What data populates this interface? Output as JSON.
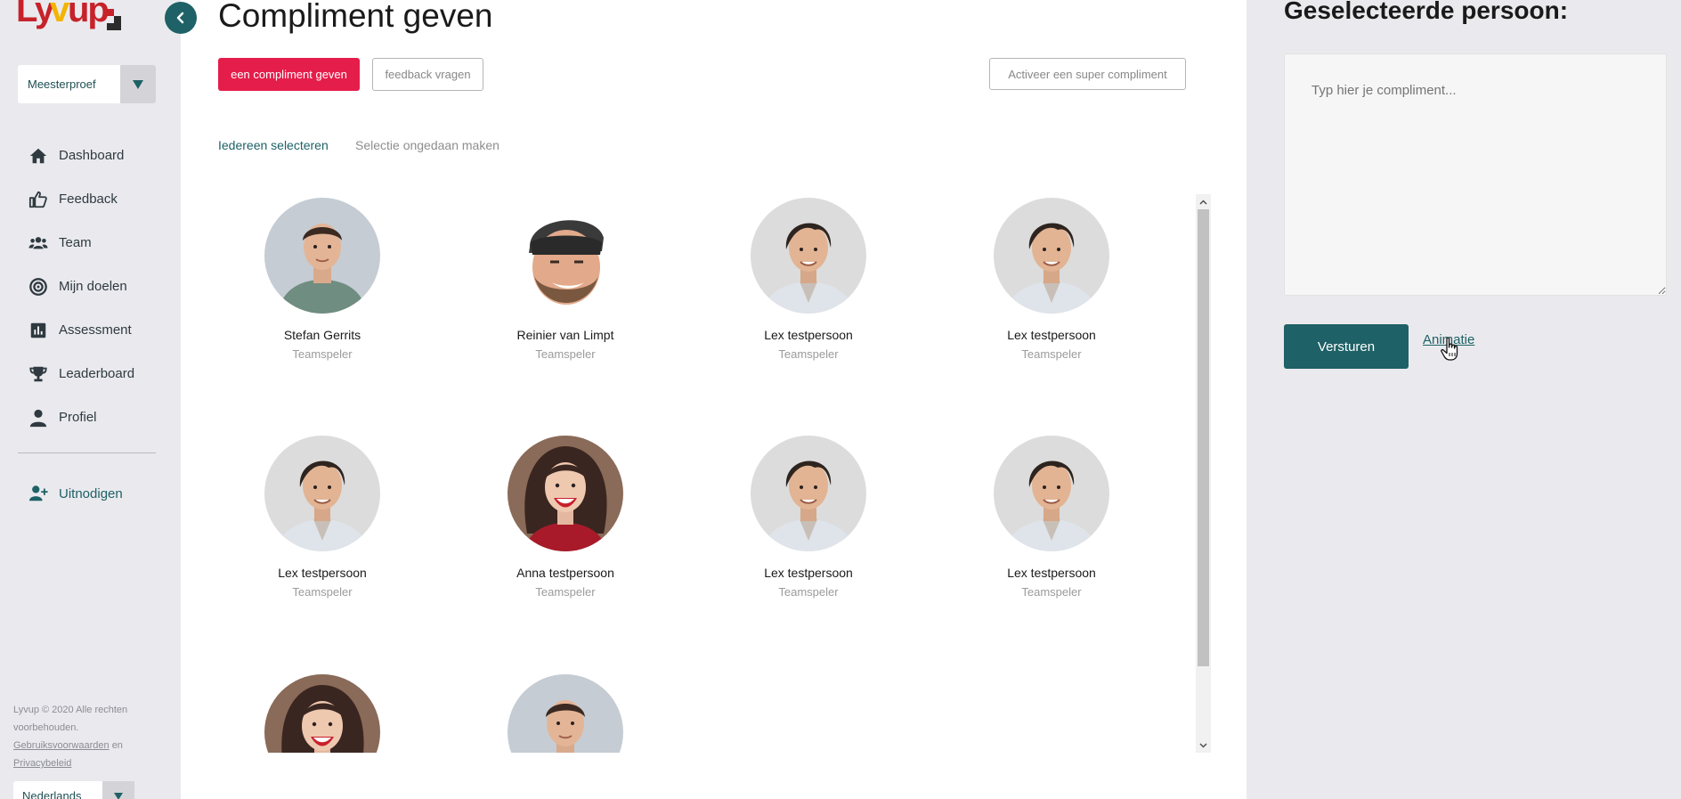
{
  "sidebar": {
    "logo_text": "Lyvup",
    "org_select": {
      "value": "Meesterproef"
    },
    "nav": [
      {
        "label": "Dashboard",
        "icon": "home-icon"
      },
      {
        "label": "Feedback",
        "icon": "thumbs-up-icon"
      },
      {
        "label": "Team",
        "icon": "users-icon"
      },
      {
        "label": "Mijn doelen",
        "icon": "target-icon"
      },
      {
        "label": "Assessment",
        "icon": "bar-chart-icon"
      },
      {
        "label": "Leaderboard",
        "icon": "trophy-icon"
      },
      {
        "label": "Profiel",
        "icon": "user-icon"
      }
    ],
    "invite": {
      "label": "Uitnodigen",
      "icon": "user-plus-icon"
    },
    "footer": {
      "copyright": "Lyvup © 2020 Alle rechten voorbehouden.",
      "terms": "Gebruiksvoorwaarden",
      "and": "en",
      "privacy": "Privacybeleid"
    },
    "language": {
      "value": "Nederlands"
    }
  },
  "main": {
    "title": "Compliment geven",
    "buttons": {
      "give": "een compliment geven",
      "ask": "feedback vragen",
      "super": "Activeer een super compliment"
    },
    "select_all": "Iedereen selecteren",
    "undo_selection": "Selectie ongedaan maken",
    "people": [
      {
        "name": "Stefan Gerrits",
        "role": "Teamspeler",
        "avatar": "young-man-green-shirt"
      },
      {
        "name": "Reinier van Limpt",
        "role": "Teamspeler",
        "avatar": "bearded-man-beanie"
      },
      {
        "name": "Lex testpersoon",
        "role": "Teamspeler",
        "avatar": "man-dark-hair"
      },
      {
        "name": "Lex testpersoon",
        "role": "Teamspeler",
        "avatar": "man-dark-hair"
      },
      {
        "name": "Lex testpersoon",
        "role": "Teamspeler",
        "avatar": "man-dark-hair"
      },
      {
        "name": "Anna testpersoon",
        "role": "Teamspeler",
        "avatar": "smiling-woman"
      },
      {
        "name": "Lex testpersoon",
        "role": "Teamspeler",
        "avatar": "man-dark-hair"
      },
      {
        "name": "Lex testpersoon",
        "role": "Teamspeler",
        "avatar": "man-dark-hair"
      },
      {
        "name": "",
        "role": "",
        "avatar": "smiling-woman"
      },
      {
        "name": "",
        "role": "",
        "avatar": "young-man-green-shirt"
      }
    ]
  },
  "right": {
    "title": "Geselecteerde persoon:",
    "compliment_placeholder": "Typ hier je compliment...",
    "send": "Versturen",
    "animation_link": "Animatie"
  },
  "colors": {
    "primary": "#1e6166",
    "accent_red": "#e51d4a",
    "sidebar_bg": "#eaeaee"
  }
}
